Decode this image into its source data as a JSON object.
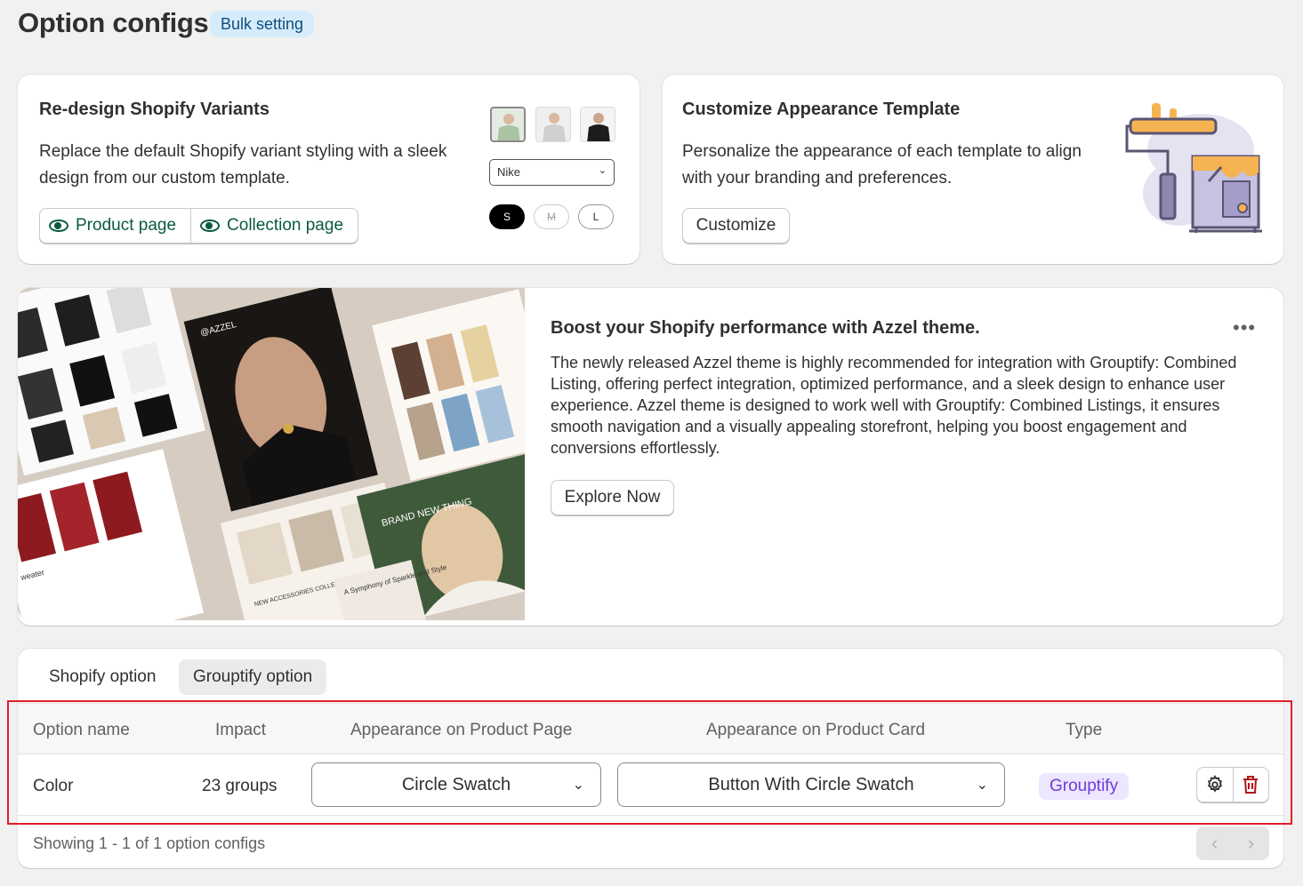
{
  "page": {
    "title": "Option configs",
    "badge": "Bulk setting"
  },
  "redesign_card": {
    "title": "Re-design Shopify Variants",
    "description": "Replace the default Shopify variant styling with a sleek design from our custom template.",
    "buttons": [
      "Product page",
      "Collection page"
    ],
    "preview": {
      "select_value": "Nike",
      "sizes": [
        "S",
        "M",
        "L"
      ]
    }
  },
  "customize_card": {
    "title": "Customize Appearance Template",
    "description": "Personalize the appearance of each template to align with your branding and preferences.",
    "button": "Customize"
  },
  "promo_card": {
    "title": "Boost your Shopify performance with Azzel theme.",
    "description": "The newly released Azzel theme is highly recommended for integration with Grouptify: Combined Listing, offering perfect integration, optimized performance, and a sleek design to enhance user experience. Azzel theme is designed to work well with Grouptify: Combined Listings, it ensures smooth navigation and a visually appealing storefront, helping you boost engagement and conversions effortlessly.",
    "button": "Explore Now",
    "image_text": {
      "brand": "@AZZEL",
      "headline": "BRAND NEW THING",
      "caption": "A Symphony of Sparkle and Style",
      "section": "NEW ACCESSORIES COLLECTIONS",
      "label": "weater"
    }
  },
  "options_table": {
    "tabs": [
      "Shopify option",
      "Grouptify option"
    ],
    "active_tab": "Grouptify option",
    "columns": [
      "Option name",
      "Impact",
      "Appearance on Product Page",
      "Appearance on Product Card",
      "Type"
    ],
    "rows": [
      {
        "name": "Color",
        "impact": "23 groups",
        "product_page": "Circle Swatch",
        "product_card": "Button With Circle Swatch",
        "type": "Grouptify"
      }
    ],
    "footer": "Showing 1 - 1 of 1 option configs"
  },
  "colors": {
    "accent_green": "#0b5a40",
    "type_pill_bg": "#ede6ff",
    "type_pill_text": "#6f3cd7",
    "highlight_border": "#e11d2a",
    "delete_icon": "#b3131b"
  }
}
